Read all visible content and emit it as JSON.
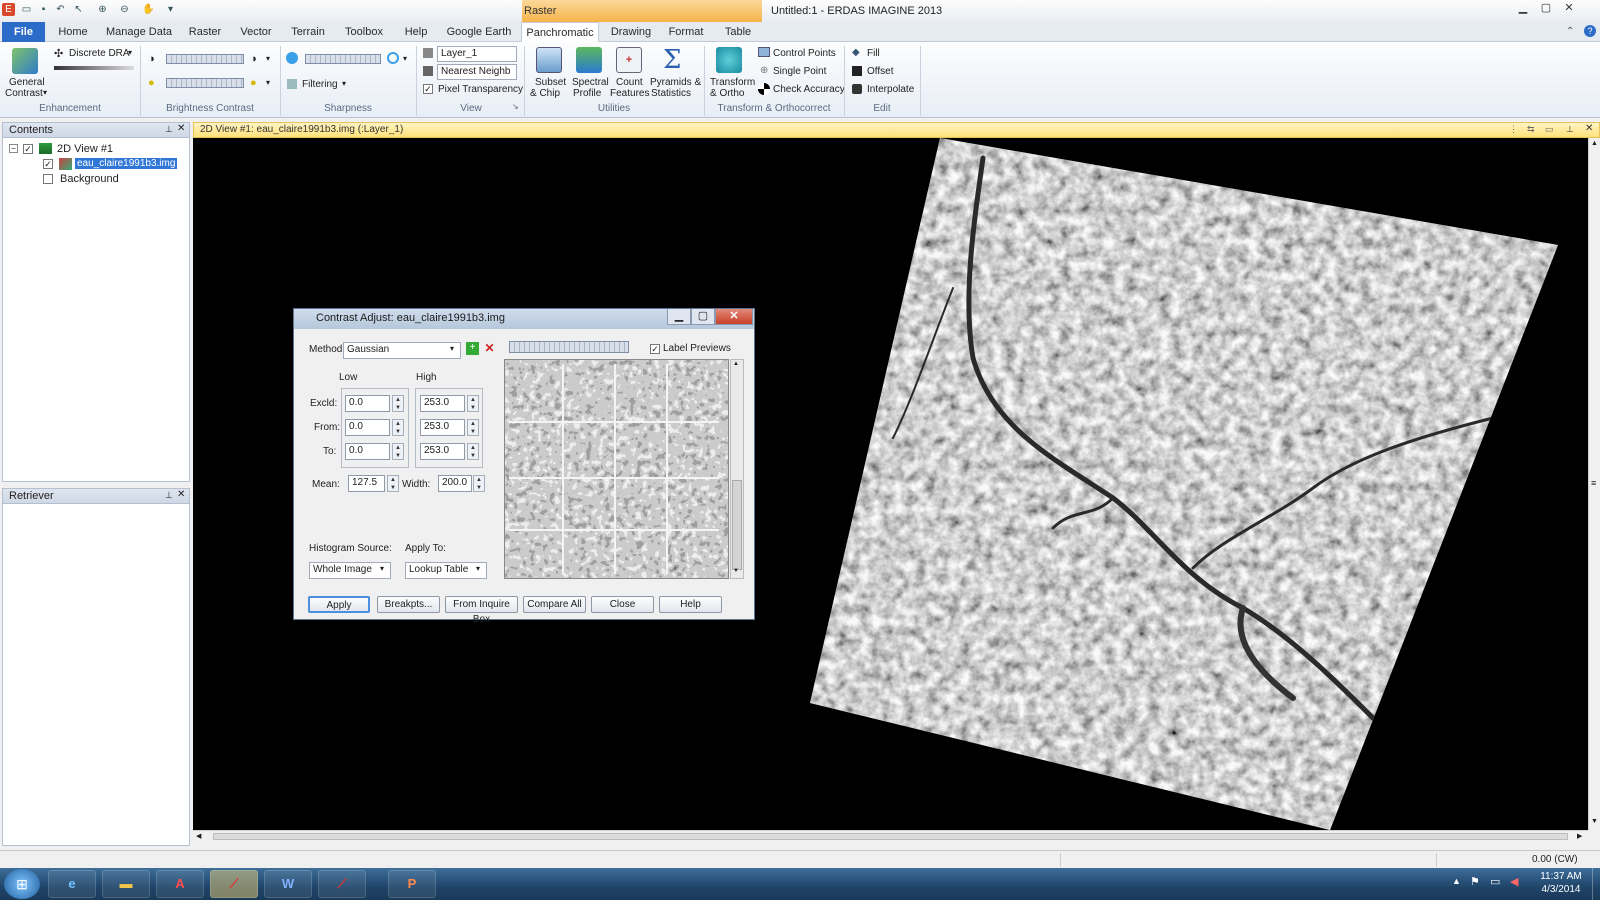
{
  "app": {
    "title": "Untitled:1 - ERDAS IMAGINE 2013",
    "context_tab_group": "Raster"
  },
  "tabs": [
    "File",
    "Home",
    "Manage Data",
    "Raster",
    "Vector",
    "Terrain",
    "Toolbox",
    "Help",
    "Google Earth",
    "Panchromatic",
    "Drawing",
    "Format",
    "Table"
  ],
  "ribbon": {
    "enhancement": {
      "general_contrast_1": "General",
      "general_contrast_2": "Contrast",
      "discrete_dra": "Discrete DRA",
      "label": "Enhancement"
    },
    "brightness_contrast": {
      "label": "Brightness Contrast"
    },
    "sharpness": {
      "filtering": "Filtering",
      "label": "Sharpness"
    },
    "view": {
      "layer": "Layer_1",
      "resample": "Nearest Neighb",
      "pixel_transparency": "Pixel Transparency",
      "label": "View"
    },
    "utilities": {
      "subset_1": "Subset",
      "subset_2": "& Chip",
      "spectral_1": "Spectral",
      "spectral_2": "Profile",
      "count_1": "Count",
      "count_2": "Features",
      "pyramids_1": "Pyramids &",
      "pyramids_2": "Statistics",
      "label": "Utilities"
    },
    "transform": {
      "transform_1": "Transform",
      "transform_2": "& Ortho",
      "control_points": "Control Points",
      "single_point": "Single Point",
      "check_accuracy": "Check Accuracy",
      "label": "Transform & Orthocorrect"
    },
    "edit": {
      "fill": "Fill",
      "offset": "Offset",
      "interpolate": "Interpolate",
      "label": "Edit"
    }
  },
  "contents": {
    "header": "Contents",
    "view": "2D View #1",
    "layer": "eau_claire1991b3.img",
    "background": "Background"
  },
  "retriever": {
    "header": "Retriever"
  },
  "viewer": {
    "title": "2D View #1: eau_claire1991b3.img (:Layer_1)"
  },
  "dialog": {
    "title": "Contrast Adjust: eau_claire1991b3.img",
    "method_label": "Method:",
    "method": "Gaussian",
    "label_previews": "Label Previews",
    "low": "Low",
    "high": "High",
    "rows": [
      {
        "label": "Excld:",
        "low": "0.0",
        "high": "253.0"
      },
      {
        "label": "From:",
        "low": "0.0",
        "high": "253.0"
      },
      {
        "label": "To:",
        "low": "0.0",
        "high": "253.0"
      }
    ],
    "mean_label": "Mean:",
    "mean": "127.5",
    "width_label": "Width:",
    "width": "200.0",
    "hist_source_label": "Histogram Source:",
    "hist_source": "Whole Image",
    "apply_to_label": "Apply To:",
    "apply_to": "Lookup Table",
    "buttons": [
      "Apply",
      "Breakpts...",
      "From Inquire Box",
      "Compare All",
      "Close",
      "Help"
    ]
  },
  "status": {
    "rotation": "0.00 (CW)"
  },
  "taskbar": {
    "time": "11:37 AM",
    "date": "4/3/2014"
  },
  "colors": {
    "ribbon_context": "#f6b34b",
    "file_tab": "#2c6bc7",
    "viewer_bg": "#000000",
    "viewer_header": "#ffe27a"
  }
}
